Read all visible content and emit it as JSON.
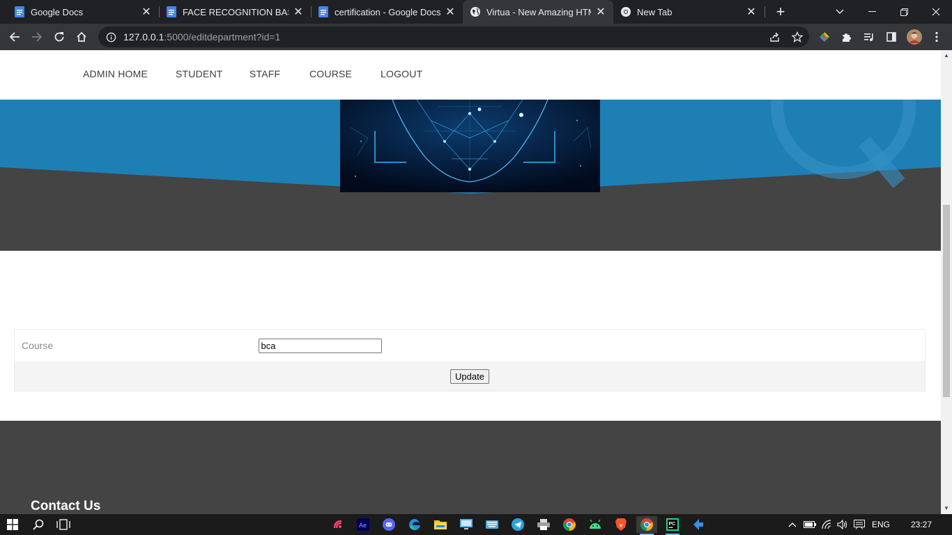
{
  "browser": {
    "tabs": [
      {
        "title": "Google Docs",
        "icon": "google-docs-icon",
        "active": false
      },
      {
        "title": "FACE RECOGNITION BASED A",
        "icon": "google-docs-icon",
        "active": false
      },
      {
        "title": "certification - Google Docs",
        "icon": "google-docs-icon",
        "active": false
      },
      {
        "title": "Virtua - New Amazing HTML",
        "icon": "globe-icon",
        "active": true
      },
      {
        "title": "New Tab",
        "icon": "chrome-icon",
        "active": false
      }
    ],
    "url_host": "127.0.0.1",
    "url_rest": ":5000/editdepartment?id=1"
  },
  "site": {
    "nav": [
      "ADMIN HOME",
      "STUDENT",
      "STAFF",
      "COURSE",
      "LOGOUT"
    ]
  },
  "form": {
    "course_label": "Course",
    "course_value": "bca",
    "update_label": "Update"
  },
  "footer": {
    "contact_heading": "Contact Us"
  },
  "taskbar": {
    "language": "ENG",
    "time": "23:27",
    "apps": [
      "windows-start-icon",
      "search-icon",
      "task-view-icon",
      "app-icon",
      "after-effects-icon",
      "discord-icon",
      "edge-icon",
      "file-explorer-icon",
      "remote-desktop-icon",
      "keyboard-icon",
      "telegram-icon",
      "printer-icon",
      "chrome-icon",
      "android-studio-icon",
      "brave-icon",
      "chrome-active-icon",
      "pycharm-icon",
      "app-arrow-icon"
    ]
  },
  "colors": {
    "hero_blue": "#1e7fb5",
    "hero_dark": "#444444",
    "footer_dark": "#444444",
    "taskbar": "#1b1b1b"
  }
}
